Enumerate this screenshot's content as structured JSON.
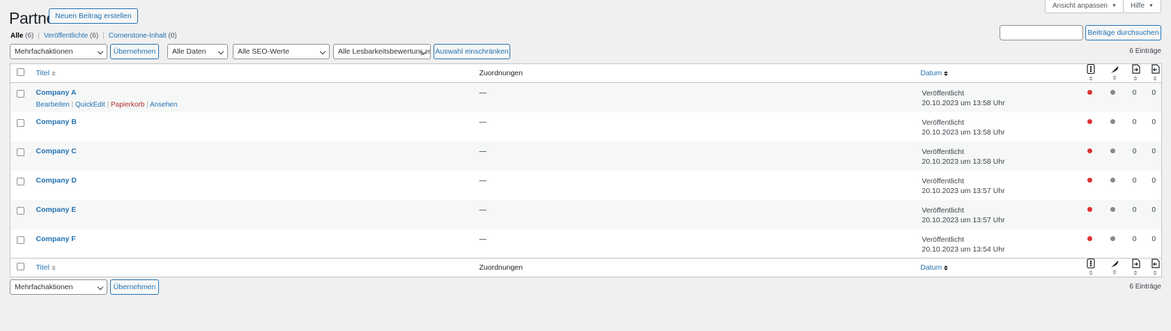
{
  "header": {
    "title": "Partner",
    "new_button": "Neuen Beitrag erstellen",
    "screen_options": "Ansicht anpassen",
    "help": "Hilfe"
  },
  "filters": {
    "all_label": "Alle",
    "all_count": "(6)",
    "published_label": "Veröffentlichte",
    "published_count": "(6)",
    "cornerstone_label": "Cornerstone-Inhalt",
    "cornerstone_count": "(0)"
  },
  "search": {
    "button": "Beiträge durchsuchen",
    "value": ""
  },
  "tablenav": {
    "bulk_actions": "Mehrfachaktionen",
    "apply": "Übernehmen",
    "dates": "Alle Daten",
    "seo": "Alle SEO-Werte",
    "readability": "Alle Lesbarkeitsbewertungen",
    "filter_button": "Auswahl einschränken",
    "item_count": "6 Einträge"
  },
  "columns": {
    "title": "Titel",
    "assignments": "Zuordnungen",
    "date": "Datum"
  },
  "icons": {
    "seo_score": "seo-score-icon",
    "readability": "readability-icon",
    "outgoing_links": "outgoing-links-icon",
    "incoming_links": "incoming-links-icon"
  },
  "row_actions": {
    "edit": "Bearbeiten",
    "quickedit": "QuickEdit",
    "trash": "Papierkorb",
    "view": "Ansehen"
  },
  "colors": {
    "seo_dot": "#dc3232",
    "readability_dot": "#888888",
    "accent": "#2271b1"
  },
  "rows": [
    {
      "title": "Company A",
      "assignment": "—",
      "status": "Veröffentlicht",
      "date": "20.10.2023 um 13:58 Uhr",
      "links_out": "0",
      "links_in": "0"
    },
    {
      "title": "Company B",
      "assignment": "—",
      "status": "Veröffentlicht",
      "date": "20.10.2023 um 13:58 Uhr",
      "links_out": "0",
      "links_in": "0"
    },
    {
      "title": "Company C",
      "assignment": "—",
      "status": "Veröffentlicht",
      "date": "20.10.2023 um 13:58 Uhr",
      "links_out": "0",
      "links_in": "0"
    },
    {
      "title": "Company D",
      "assignment": "—",
      "status": "Veröffentlicht",
      "date": "20.10.2023 um 13:57 Uhr",
      "links_out": "0",
      "links_in": "0"
    },
    {
      "title": "Company E",
      "assignment": "—",
      "status": "Veröffentlicht",
      "date": "20.10.2023 um 13:57 Uhr",
      "links_out": "0",
      "links_in": "0"
    },
    {
      "title": "Company F",
      "assignment": "—",
      "status": "Veröffentlicht",
      "date": "20.10.2023 um 13:54 Uhr",
      "links_out": "0",
      "links_in": "0"
    }
  ]
}
